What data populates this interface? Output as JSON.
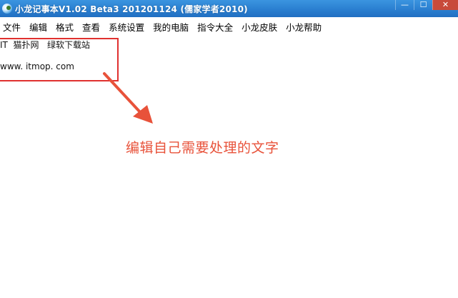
{
  "window": {
    "title": "小龙记事本V1.02 Beta3 201201124 (儒家学者2010)",
    "controls": {
      "minimize": "—",
      "maximize": "☐",
      "close": "✕"
    }
  },
  "menubar": {
    "items": [
      "文件",
      "编辑",
      "格式",
      "查看",
      "系统设置",
      "我的电脑",
      "指令大全",
      "小龙皮肤",
      "小龙帮助"
    ]
  },
  "editor": {
    "lines": [
      "IT  猫扑网   绿软下载站",
      "www. itmop. com"
    ]
  },
  "annotation": {
    "text": "编辑自己需要处理的文字",
    "color": "#e8523a"
  },
  "colors": {
    "titlebar": "#2a7fd0",
    "highlight": "#e0312f"
  }
}
